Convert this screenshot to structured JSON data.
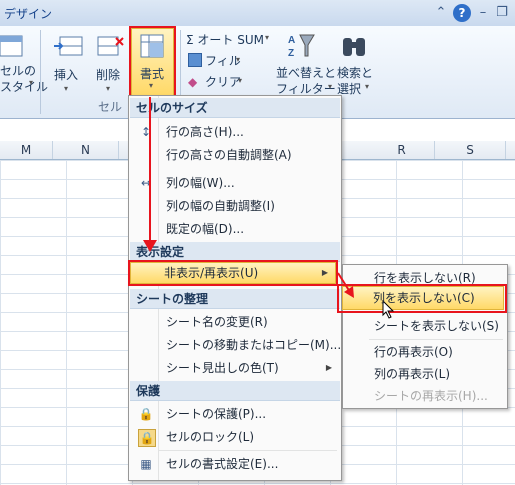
{
  "titlebar": {
    "tab": "デザイン",
    "icons": [
      "caret-up-icon",
      "help-icon",
      "minimize-icon",
      "restore-icon",
      "close-icon"
    ]
  },
  "ribbon": {
    "style_btn": [
      "セルの",
      "スタイル"
    ],
    "insert": "挿入",
    "delete": "削除",
    "format": "書式",
    "group_cells": "セル",
    "autosum": "Σ オート SUM",
    "fill": "フィル",
    "clear": "クリア",
    "sort": [
      "並べ替えと",
      "フィルター"
    ],
    "find": [
      "検索と",
      "選択"
    ]
  },
  "columns": [
    "M",
    "N",
    "R",
    "S"
  ],
  "menu": {
    "sec1": "セルのサイズ",
    "row_height": "行の高さ(H)...",
    "row_autofit": "行の高さの自動調整(A)",
    "col_width": "列の幅(W)...",
    "col_autofit": "列の幅の自動調整(I)",
    "default_width": "既定の幅(D)...",
    "sec2": "表示設定",
    "hide_unhide": "非表示/再表示(U)",
    "sec3": "シートの整理",
    "rename": "シート名の変更(R)",
    "move_copy": "シートの移動またはコピー(M)...",
    "tab_color": "シート見出しの色(T)",
    "sec4": "保護",
    "protect": "シートの保護(P)...",
    "lock": "セルのロック(L)",
    "format_cells": "セルの書式設定(E)..."
  },
  "submenu": {
    "hide_rows": "行を表示しない(R)",
    "hide_cols": "列を表示しない(C)",
    "hide_sheet": "シートを表示しない(S)",
    "unhide_rows": "行の再表示(O)",
    "unhide_cols": "列の再表示(L)",
    "unhide_sheet": "シートの再表示(H)..."
  },
  "colors": {
    "annotation": "#e8141d",
    "highlight": "#ffd968"
  }
}
